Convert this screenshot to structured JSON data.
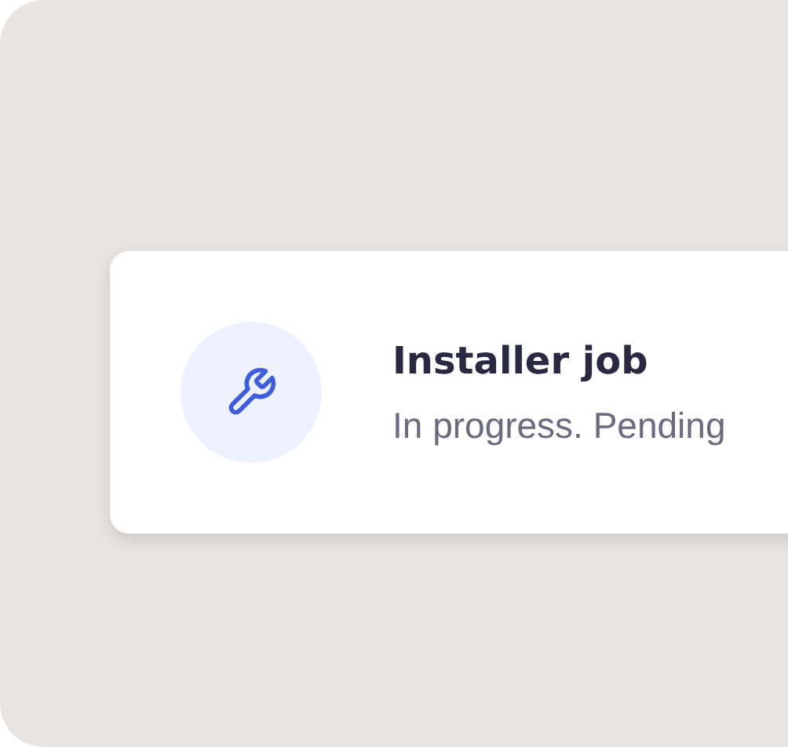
{
  "card": {
    "title": "Installer job",
    "subtitle": "In progress. Pending"
  }
}
